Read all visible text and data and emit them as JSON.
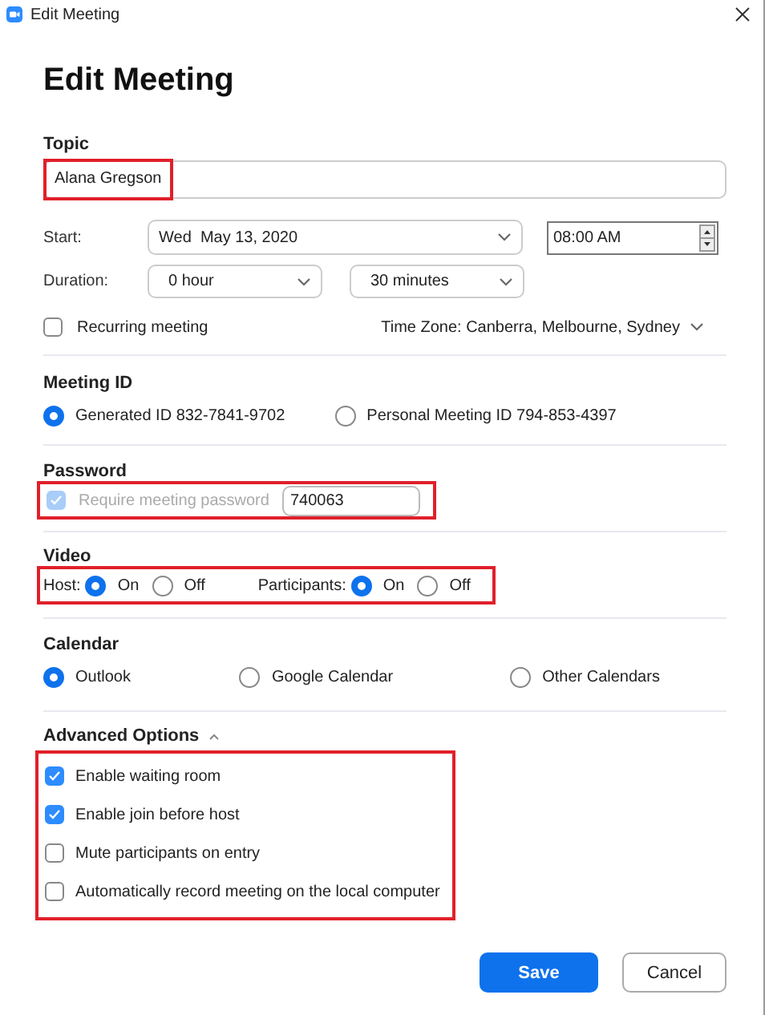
{
  "window": {
    "title": "Edit Meeting"
  },
  "heading": "Edit Meeting",
  "topic": {
    "label": "Topic",
    "value": "Alana Gregson",
    "highlighted": true
  },
  "start": {
    "label": "Start:",
    "date": "Wed  May 13, 2020",
    "time": "08:00 AM"
  },
  "duration": {
    "label": "Duration:",
    "hours": "0 hour",
    "minutes": "30 minutes"
  },
  "recurring": {
    "label": "Recurring meeting",
    "checked": false
  },
  "time_zone": "Time Zone: Canberra, Melbourne, Sydney",
  "meeting_id": {
    "label": "Meeting ID",
    "options": [
      {
        "label": "Generated ID 832-7841-9702",
        "selected": true
      },
      {
        "label": "Personal Meeting ID 794-853-4397",
        "selected": false
      }
    ]
  },
  "password": {
    "label": "Password",
    "highlighted": true,
    "require": {
      "label": "Require meeting password",
      "checked": true,
      "disabled": true
    },
    "value": "740063"
  },
  "video": {
    "label": "Video",
    "highlighted": true,
    "groups": [
      {
        "label": "Host:",
        "options": [
          {
            "label": "On",
            "selected": true
          },
          {
            "label": "Off",
            "selected": false
          }
        ]
      },
      {
        "label": "Participants:",
        "options": [
          {
            "label": "On",
            "selected": true
          },
          {
            "label": "Off",
            "selected": false
          }
        ]
      }
    ]
  },
  "calendar": {
    "label": "Calendar",
    "options": [
      {
        "label": "Outlook",
        "selected": true
      },
      {
        "label": "Google Calendar",
        "selected": false
      },
      {
        "label": "Other Calendars",
        "selected": false
      }
    ]
  },
  "advanced": {
    "label": "Advanced Options",
    "expanded": true,
    "highlighted": true,
    "options": [
      {
        "label": "Enable waiting room",
        "checked": true
      },
      {
        "label": "Enable join before host",
        "checked": true
      },
      {
        "label": "Mute participants on entry",
        "checked": false
      },
      {
        "label": "Automatically record meeting on the local computer",
        "checked": false
      }
    ]
  },
  "buttons": [
    {
      "label": "Save",
      "kind": "primary"
    },
    {
      "label": "Cancel",
      "kind": "secondary"
    }
  ]
}
